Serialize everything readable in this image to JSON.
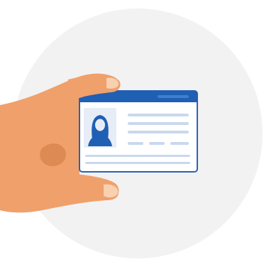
{
  "illustration": {
    "subject": "hand-holding-id-card",
    "icons": [
      "id-card-icon",
      "hand-icon",
      "avatar-icon"
    ],
    "colors": {
      "background_circle": "#f2f2f2",
      "card_header": "#1f5fb4",
      "card_header_light": "#3e7fd0",
      "card_border": "#2a63b7",
      "card_body": "#ffffff",
      "photo_frame": "#e7edf6",
      "photo_silhouette": "#1f5fb4",
      "text_lines": "#c9d8ee",
      "skin_main": "#f0a06b",
      "skin_shadow": "#d9844f",
      "nail": "#f8d6b8"
    }
  }
}
